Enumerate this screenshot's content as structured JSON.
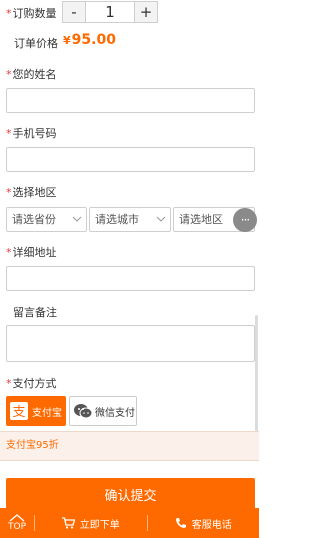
{
  "quantity": {
    "label": "订购数量",
    "minus": "-",
    "value": "1",
    "plus": "+"
  },
  "order_price": {
    "label": "订单价格",
    "currency": "¥",
    "value": "95.00"
  },
  "name": {
    "label": "您的姓名"
  },
  "phone": {
    "label": "手机号码"
  },
  "region": {
    "label": "选择地区",
    "province": "请选省份",
    "city": "请选城市",
    "district": "请选地区",
    "more": "···"
  },
  "address": {
    "label": "详细地址"
  },
  "remark": {
    "label": "留言备注"
  },
  "payment": {
    "label": "支付方式",
    "alipay": "支付宝",
    "wechat": "微信支付",
    "discount": "支付宝95折"
  },
  "submit": {
    "label": "确认提交"
  },
  "bottom": {
    "top": "TOP",
    "buy": "立即下单",
    "service": "客服电话"
  },
  "colors": {
    "accent": "#ff6a00",
    "required": "#e4393c"
  }
}
